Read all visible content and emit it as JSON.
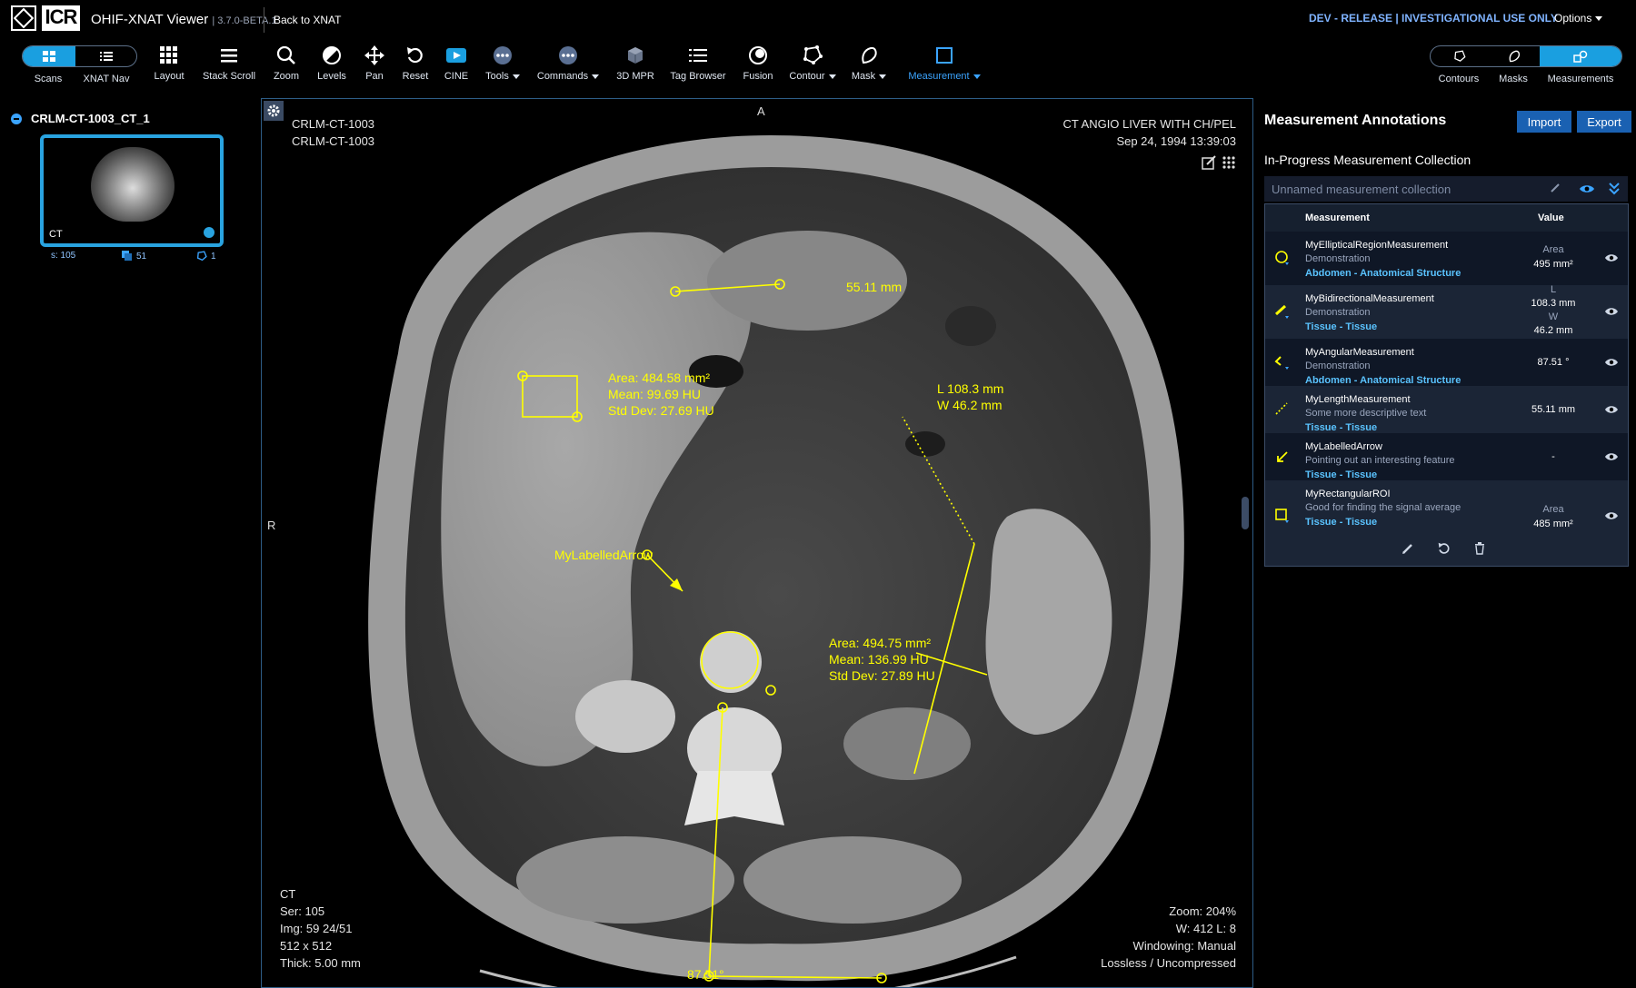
{
  "header": {
    "app_title": "OHIF-XNAT Viewer",
    "version": "| 3.7.0-BETA.1",
    "back_link": "Back to XNAT",
    "release_notice": "DEV - RELEASE | INVESTIGATIONAL USE ONLY",
    "options_label": "Options"
  },
  "left_toggle": {
    "scans_label": "Scans",
    "nav_label": "XNAT Nav",
    "active": "Scans"
  },
  "toolbar": [
    {
      "id": "layout",
      "label": "Layout",
      "icon": "grid-icon"
    },
    {
      "id": "stack-scroll",
      "label": "Stack Scroll",
      "icon": "stack-scroll-icon"
    },
    {
      "id": "zoom",
      "label": "Zoom",
      "icon": "zoom-icon"
    },
    {
      "id": "levels",
      "label": "Levels",
      "icon": "levels-icon"
    },
    {
      "id": "pan",
      "label": "Pan",
      "icon": "pan-icon"
    },
    {
      "id": "reset",
      "label": "Reset",
      "icon": "reset-icon"
    },
    {
      "id": "cine",
      "label": "CINE",
      "icon": "cine-icon"
    },
    {
      "id": "tools",
      "label": "Tools",
      "icon": "more-icon"
    },
    {
      "id": "commands",
      "label": "Commands",
      "icon": "more-icon"
    },
    {
      "id": "3d-mpr",
      "label": "3D MPR",
      "icon": "cube-icon"
    },
    {
      "id": "tag-browser",
      "label": "Tag Browser",
      "icon": "list-icon"
    },
    {
      "id": "fusion",
      "label": "Fusion",
      "icon": "fusion-icon"
    },
    {
      "id": "contour",
      "label": "Contour",
      "icon": "contour-icon"
    },
    {
      "id": "mask",
      "label": "Mask",
      "icon": "mask-icon"
    },
    {
      "id": "measurement",
      "label": "Measurement",
      "icon": "measurement-icon",
      "active": true
    }
  ],
  "right_toggle": {
    "contours_label": "Contours",
    "masks_label": "Masks",
    "measurements_label": "Measurements",
    "active": "Measurements"
  },
  "study": {
    "name": "CRLM-CT-1003_CT_1",
    "thumb_modality": "CT",
    "series_label": "s: 105",
    "instances": "51",
    "annotations": "1"
  },
  "viewport": {
    "top_left": [
      "CRLM-CT-1003",
      "CRLM-CT-1003"
    ],
    "top_right": [
      "CT ANGIO LIVER WITH CH/PEL",
      "Sep 24, 1994 13:39:03"
    ],
    "bottom_left": [
      "CT",
      "Ser: 105",
      "Img: 59 24/51",
      "512 x 512",
      "Thick: 5.00 mm"
    ],
    "bottom_right": [
      "Zoom: 204%",
      "W: 412 L: 8",
      "Windowing: Manual",
      "Lossless / Uncompressed"
    ],
    "orientation_top": "A",
    "orientation_left": "R",
    "annotations": {
      "length": "55.11 mm",
      "rect": [
        "Area: 484.58 mm²",
        "Mean: 99.69 HU",
        "Std Dev: 27.69 HU"
      ],
      "bidir": [
        "L 108.3 mm",
        "W 46.2 mm"
      ],
      "arrow": "MyLabelledArrow",
      "ellipse": [
        "Area: 494.75 mm²",
        "Mean: 136.99 HU",
        "Std Dev: 27.89 HU"
      ],
      "angle": "87.51°"
    }
  },
  "measurement_panel": {
    "title": "Measurement Annotations",
    "import_label": "Import",
    "export_label": "Export",
    "collection_title": "In-Progress Measurement Collection",
    "collection_placeholder": "Unnamed measurement collection",
    "col_measurement": "Measurement",
    "col_value": "Value",
    "rows": [
      {
        "name": "MyEllipticalRegionMeasurement",
        "desc": "Demonstration",
        "loc": "Abdomen - Anatomical Structure",
        "val": [
          "Area",
          "495 mm²"
        ],
        "icon": "ellipse-icon"
      },
      {
        "name": "MyBidirectionalMeasurement",
        "desc": "Demonstration",
        "loc": "Tissue - Tissue",
        "val": [
          "L",
          "108.3 mm",
          "W",
          "46.2 mm"
        ],
        "icon": "bidirectional-icon"
      },
      {
        "name": "MyAngularMeasurement",
        "desc": "Demonstration",
        "loc": "Abdomen - Anatomical Structure",
        "val": [
          "87.51 °"
        ],
        "icon": "angle-icon"
      },
      {
        "name": "MyLengthMeasurement",
        "desc": "Some more descriptive text",
        "loc": "Tissue - Tissue",
        "val": [
          "55.11 mm"
        ],
        "icon": "length-icon"
      },
      {
        "name": "MyLabelledArrow",
        "desc": "Pointing out an interesting feature",
        "loc": "Tissue - Tissue",
        "val": [
          "-"
        ],
        "icon": "arrow-icon"
      },
      {
        "name": "MyRectangularROI",
        "desc": "Good for finding the signal average",
        "loc": "Tissue - Tissue",
        "val": [
          "Area",
          "485 mm²"
        ],
        "icon": "rectangle-icon"
      }
    ]
  }
}
